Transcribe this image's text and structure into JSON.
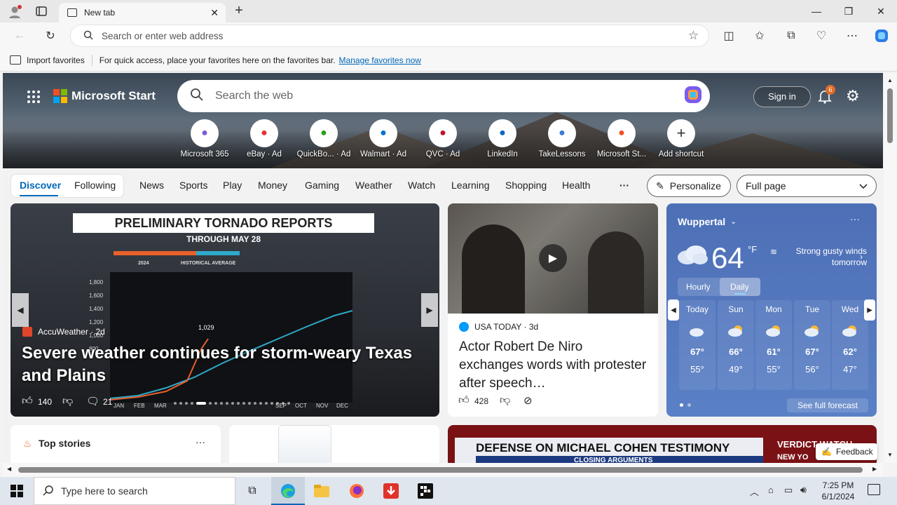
{
  "browser": {
    "tab_title": "New tab",
    "address_placeholder": "Search or enter web address",
    "fav_import": "Import favorites",
    "fav_hint": "For quick access, place your favorites here on the favorites bar.",
    "fav_manage": "Manage favorites now"
  },
  "header": {
    "brand": "Microsoft Start",
    "search_placeholder": "Search the web",
    "sign_in": "Sign in",
    "notif_count": "6"
  },
  "shortcuts": [
    {
      "label": "Microsoft 365",
      "icon": "microsoft-365-icon",
      "color": "#7b5cd6"
    },
    {
      "label": "eBay · Ad",
      "icon": "ebay-icon",
      "color": "#e53238"
    },
    {
      "label": "QuickBo... · Ad",
      "icon": "quickbooks-icon",
      "color": "#2ca01c"
    },
    {
      "label": "Walmart · Ad",
      "icon": "walmart-icon",
      "color": "#0071ce"
    },
    {
      "label": "QVC · Ad",
      "icon": "qvc-icon",
      "color": "#c8102e"
    },
    {
      "label": "LinkedIn",
      "icon": "linkedin-icon",
      "color": "#0a66c2"
    },
    {
      "label": "TakeLessons",
      "icon": "takelessons-icon",
      "color": "#3a7bd5"
    },
    {
      "label": "Microsoft St...",
      "icon": "microsoft-store-icon",
      "color": "#f25022"
    },
    {
      "label": "Add shortcut",
      "icon": "plus-icon",
      "color": "#333333"
    }
  ],
  "nav": {
    "discover": "Discover",
    "following": "Following",
    "items": [
      "News",
      "Sports",
      "Play",
      "Money",
      "Gaming",
      "Weather",
      "Watch",
      "Learning",
      "Shopping",
      "Health"
    ],
    "more": "···",
    "personalize": "Personalize",
    "layout": "Full page"
  },
  "hero_story": {
    "graphic_title": "PRELIMINARY TORNADO REPORTS",
    "graphic_sub": "THROUGH MAY 28",
    "legend_2024": "2024",
    "legend_hist": "HISTORICAL AVERAGE",
    "y_ticks": [
      "1,800",
      "1,600",
      "1,400",
      "1,200",
      "1,000",
      "800"
    ],
    "months": [
      "JAN",
      "FEB",
      "MAR",
      "SEP",
      "OCT",
      "NOV",
      "DEC"
    ],
    "point_label": "1,029",
    "source": "AccuWeather",
    "age": "· 2d",
    "headline": "Severe weather continues for storm-weary Texas and Plains",
    "likes": "140",
    "comments": "21"
  },
  "side_story": {
    "source": "USA TODAY",
    "age": "· 3d",
    "headline": "Actor Robert De Niro exchanges words with protester after speech…",
    "likes": "428"
  },
  "weather": {
    "location": "Wuppertal",
    "temp": "64",
    "unit": "°F",
    "alert": "Strong gusty winds tomorrow",
    "tab_hourly": "Hourly",
    "tab_daily": "Daily",
    "days": [
      {
        "day": "Today",
        "hi": "67°",
        "lo": "55°",
        "icon": "rain-cloud-icon"
      },
      {
        "day": "Sun",
        "hi": "66°",
        "lo": "49°",
        "icon": "partly-cloudy-icon"
      },
      {
        "day": "Mon",
        "hi": "61°",
        "lo": "55°",
        "icon": "partly-cloudy-icon"
      },
      {
        "day": "Tue",
        "hi": "67°",
        "lo": "56°",
        "icon": "rain-sun-icon"
      },
      {
        "day": "Wed",
        "hi": "62°",
        "lo": "47°",
        "icon": "sun-cloud-icon"
      }
    ],
    "see_full": "See full forecast"
  },
  "bottom": {
    "top_stories": "Top stories",
    "banner_text": "DEFENSE ON MICHAEL COHEN TESTIMONY",
    "banner_sub": "CLOSING ARGUMENTS",
    "banner_right": "VERDICT WATCH",
    "banner_right_sub": "NEW YO",
    "feedback": "Feedback"
  },
  "taskbar": {
    "search_placeholder": "Type here to search",
    "time": "7:25 PM",
    "date": "6/1/2024"
  },
  "colors": {
    "accent": "#0067b8",
    "taskbar": "#dfe6ee"
  }
}
